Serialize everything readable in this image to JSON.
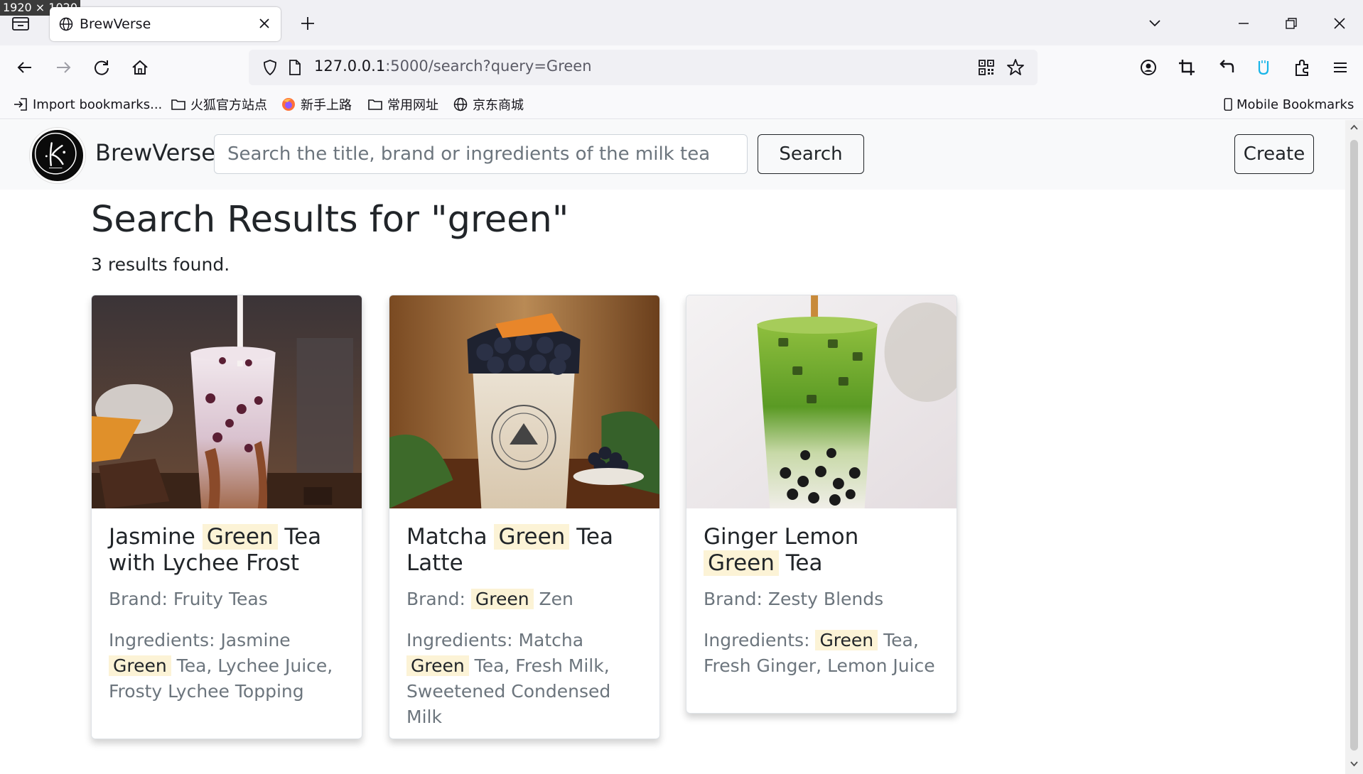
{
  "window": {
    "dimensions_badge": "1920 × 1020"
  },
  "browser": {
    "tab_title": "BrewVerse",
    "url_host": "127.0.0.1",
    "url_rest": ":5000/search?query=Green",
    "bookmarks": [
      {
        "label": "Import bookmarks...",
        "icon": "import-icon"
      },
      {
        "label": "火狐官方站点",
        "icon": "folder-icon"
      },
      {
        "label": "新手上路",
        "icon": "firefox-icon"
      },
      {
        "label": "常用网址",
        "icon": "folder-icon"
      },
      {
        "label": "京东商城",
        "icon": "globe-icon"
      }
    ],
    "mobile_bookmarks": "Mobile Bookmarks"
  },
  "site": {
    "brand": "BrewVerse",
    "search_placeholder": "Search the title, brand or ingredients of the milk tea",
    "search_button": "Search",
    "create_button": "Create"
  },
  "results": {
    "heading": "Search Results for \"green\"",
    "count_text": "3 results found.",
    "highlight": "Green",
    "cards": [
      {
        "title_pre": "Jasmine ",
        "title_post": " Tea with Lychee Frost",
        "brand_label": "Brand: ",
        "brand_pre": "Fruity Teas",
        "brand_hl": false,
        "brand_post": "",
        "ingr_label": "Ingredients: ",
        "ingr_pre": "Jasmine ",
        "ingr_post": " Tea, Lychee Juice, Frosty Lychee Topping"
      },
      {
        "title_pre": "Matcha ",
        "title_post": " Tea Latte",
        "brand_label": "Brand: ",
        "brand_pre": "",
        "brand_hl": true,
        "brand_post": " Zen",
        "ingr_label": "Ingredients: ",
        "ingr_pre": "Matcha ",
        "ingr_post": " Tea, Fresh Milk, Sweetened Condensed Milk"
      },
      {
        "title_pre": "Ginger Lemon ",
        "title_post": " Tea",
        "brand_label": "Brand: ",
        "brand_pre": "Zesty Blends",
        "brand_hl": false,
        "brand_post": "",
        "ingr_label": "Ingredients: ",
        "ingr_pre": "",
        "ingr_post": " Tea, Fresh Ginger, Lemon Juice"
      }
    ]
  },
  "colors": {
    "highlight_bg": "#fcf3d6",
    "muted_text": "#6c757d",
    "navbar_bg": "#f8f9fa"
  }
}
